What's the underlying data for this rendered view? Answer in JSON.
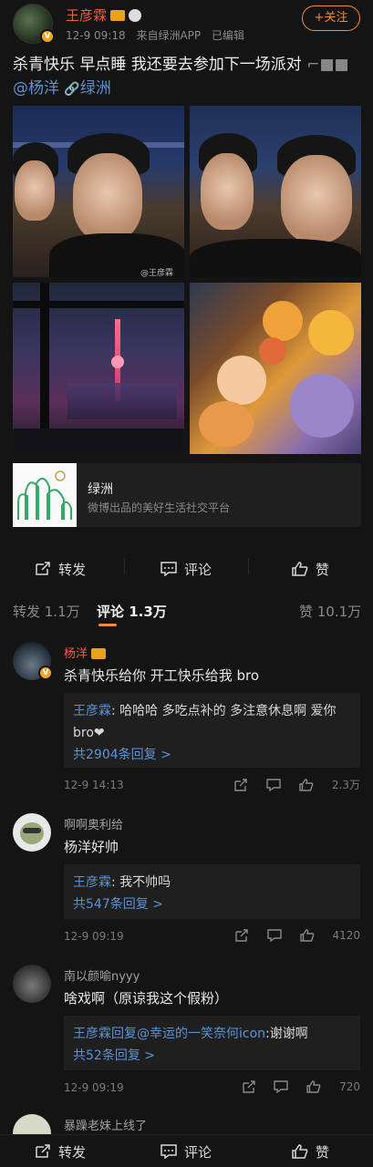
{
  "post": {
    "author": "王彦霖",
    "time": "12-9 09:18",
    "source": "来自绿洲APP",
    "edited": "已编辑",
    "follow_label": "+关注",
    "text": "杀青快乐  早点睡 我还要去参加下一场派对",
    "mention": "@杨洋",
    "link_label": "绿洲",
    "photo_watermark": "@王彦霖"
  },
  "card": {
    "title": "绿洲",
    "subtitle": "微博出品的美好生活社交平台"
  },
  "actions": {
    "repost": "转发",
    "comment": "评论",
    "like": "赞"
  },
  "tabs": {
    "repost": "转发 1.1万",
    "comment": "评论 1.3万",
    "like": "赞 10.1万"
  },
  "comments": [
    {
      "name": "杨洋",
      "text": "杀青快乐给你 开工快乐给我 bro",
      "reply_name": "王彦霖",
      "reply_text": "哈哈哈 多吃点补的 多注意休息啊 爱你bro❤",
      "reply_more": "共2904条回复 >",
      "time": "12-9 14:13",
      "likes": "2.3万"
    },
    {
      "name": "啊啊奥利给",
      "text": "杨洋好帅",
      "reply_name": "王彦霖",
      "reply_text": "我不帅吗",
      "reply_more": "共547条回复 >",
      "time": "12-9 09:19",
      "likes": "4120"
    },
    {
      "name": "南以颜喻nyyy",
      "text": "啥戏啊（原谅我这个假粉）",
      "reply_name": "王彦霖回复@幸运的一笑奈何icon",
      "reply_text": "谢谢啊",
      "reply_more": "共52条回复 >",
      "time": "12-9 09:19",
      "likes": "720"
    },
    {
      "name": "暴躁老妹上线了"
    }
  ],
  "colors": {
    "background": "#141414",
    "accent": "#f28b3c",
    "vip_name": "#f05a3f",
    "link": "#5a93d6"
  }
}
